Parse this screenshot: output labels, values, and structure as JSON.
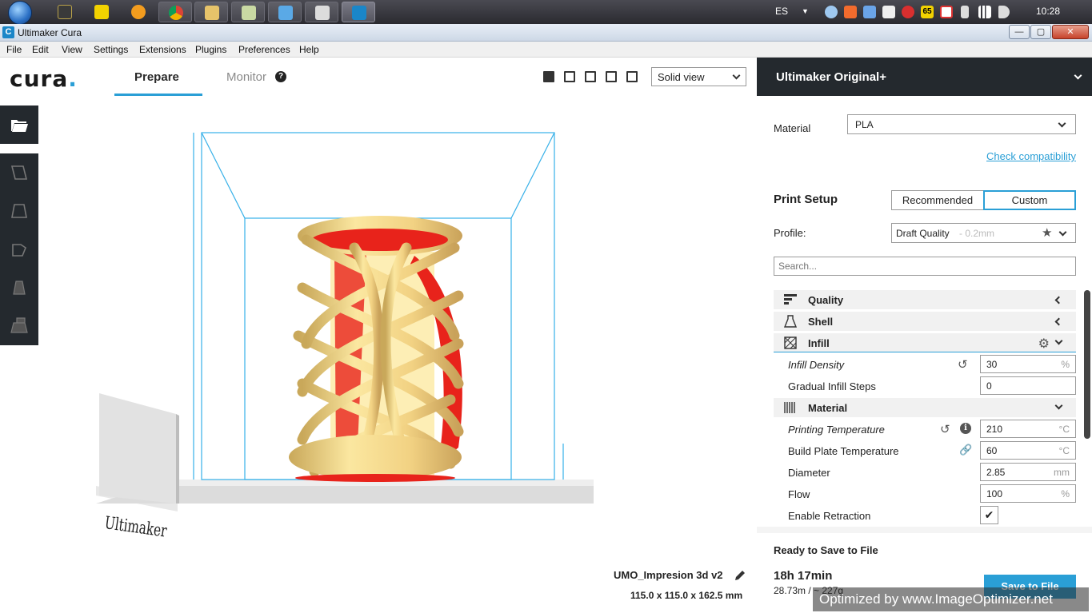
{
  "taskbar": {
    "language": "ES",
    "clock": "10:28",
    "tray_badge": "65"
  },
  "window": {
    "title": "Ultimaker Cura",
    "icon_letter": "C",
    "min": "—",
    "max": "▢",
    "close": "✕"
  },
  "menu": [
    "File",
    "Edit",
    "View",
    "Settings",
    "Extensions",
    "Plugins",
    "Preferences",
    "Help"
  ],
  "header": {
    "logo_text": "cura",
    "logo_dot": ".",
    "tabs": {
      "prepare": "Prepare",
      "monitor": "Monitor"
    },
    "help_glyph": "?",
    "view_mode": "Solid view"
  },
  "viewport": {
    "brand_plate_text": "Ultimaker",
    "object_name": "UMO_Impresion 3d v2",
    "object_dims": "115.0 x 115.0 x 162.5 mm"
  },
  "sidebar": {
    "printer_name": "Ultimaker Original+",
    "material_label": "Material",
    "material_value": "PLA",
    "check_compatibility": "Check compatibility",
    "print_setup_title": "Print Setup",
    "mode_recommended": "Recommended",
    "mode_custom": "Custom",
    "profile_label": "Profile:",
    "profile_name": "Draft Quality",
    "profile_sub": " - 0.2mm",
    "search_placeholder": "Search...",
    "categories": {
      "quality": "Quality",
      "shell": "Shell",
      "infill": "Infill",
      "material": "Material"
    },
    "settings": {
      "infill_density": {
        "label": "Infill Density",
        "value": "30",
        "unit": "%"
      },
      "gradual_infill": {
        "label": "Gradual Infill Steps",
        "value": "0",
        "unit": ""
      },
      "print_temp": {
        "label": "Printing Temperature",
        "value": "210",
        "unit": "°C"
      },
      "bed_temp": {
        "label": "Build Plate Temperature",
        "value": "60",
        "unit": "°C"
      },
      "diameter": {
        "label": "Diameter",
        "value": "2.85",
        "unit": "mm"
      },
      "flow": {
        "label": "Flow",
        "value": "100",
        "unit": "%"
      },
      "retraction": {
        "label": "Enable Retraction",
        "checked": "✔"
      }
    },
    "ready_text": "Ready to Save to File",
    "print_time": "18h 17min",
    "filament": "28.73m / ~ 227g",
    "save_button": "Save to File"
  },
  "watermark": "Optimized by www.ImageOptimizer.net",
  "colors": {
    "accent": "#2a9fd6",
    "dark_panel": "#24292e",
    "model_yellow": "#f5dd8a",
    "overhang_red": "#e8231b"
  }
}
